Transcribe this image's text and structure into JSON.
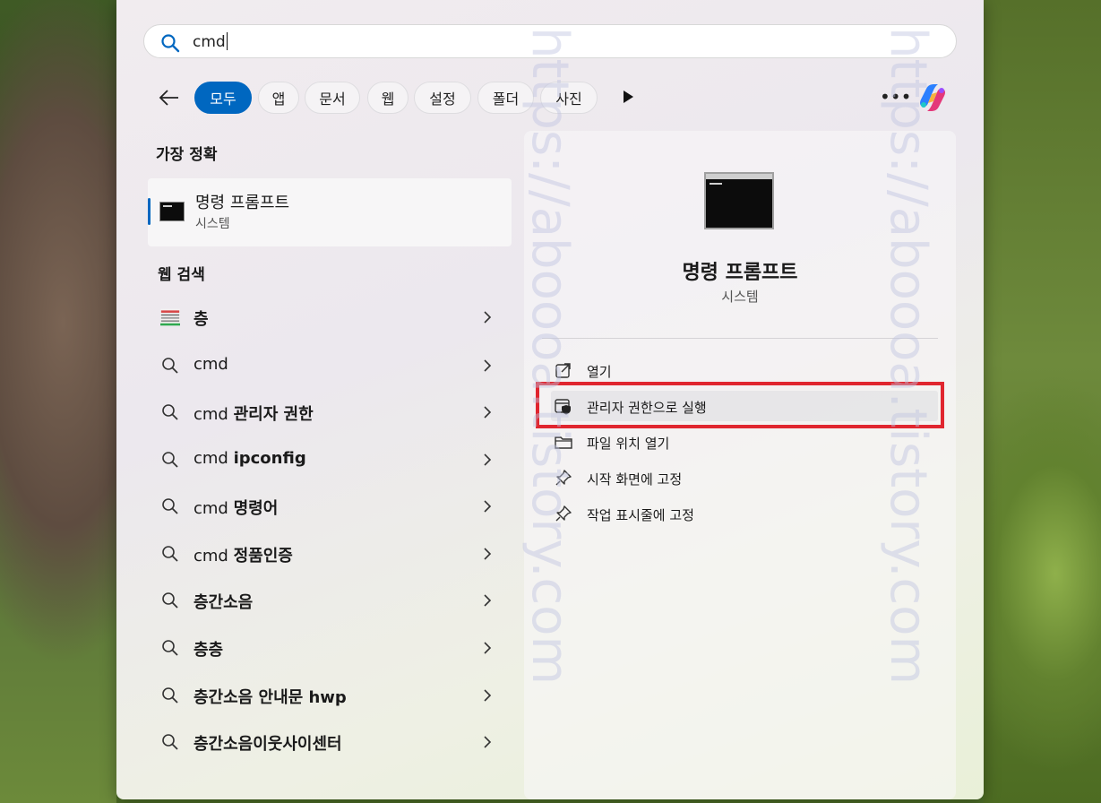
{
  "search": {
    "query": "cmd"
  },
  "filters": {
    "back_label": "←",
    "chips": [
      "모두",
      "앱",
      "문서",
      "웹",
      "설정",
      "폴더",
      "사진"
    ],
    "active_index": 0
  },
  "best_match": {
    "section_title": "가장 정확",
    "name": "명령 프롬프트",
    "subtitle": "시스템"
  },
  "web_search": {
    "section_title": "웹 검색",
    "items": [
      {
        "plain": "",
        "bold": "층"
      },
      {
        "plain": "cmd",
        "bold": ""
      },
      {
        "plain": "cmd ",
        "bold": "관리자 권한"
      },
      {
        "plain": "cmd ",
        "bold": "ipconfig"
      },
      {
        "plain": "cmd ",
        "bold": "명령어"
      },
      {
        "plain": "cmd ",
        "bold": "정품인증"
      },
      {
        "plain": "",
        "bold": "층간소음"
      },
      {
        "plain": "",
        "bold": "층층"
      },
      {
        "plain": "",
        "bold": "층간소음 안내문 hwp"
      },
      {
        "plain": "",
        "bold": "층간소음이웃사이센터"
      }
    ]
  },
  "detail": {
    "name": "명령 프롬프트",
    "subtitle": "시스템",
    "actions": [
      "열기",
      "관리자 권한으로 실행",
      "파일 위치 열기",
      "시작 화면에 고정",
      "작업 표시줄에 고정"
    ]
  },
  "watermark": {
    "text": "https://aboooa.tistory.com"
  },
  "colors": {
    "accent": "#0067c0",
    "highlight": "#e0262f"
  }
}
